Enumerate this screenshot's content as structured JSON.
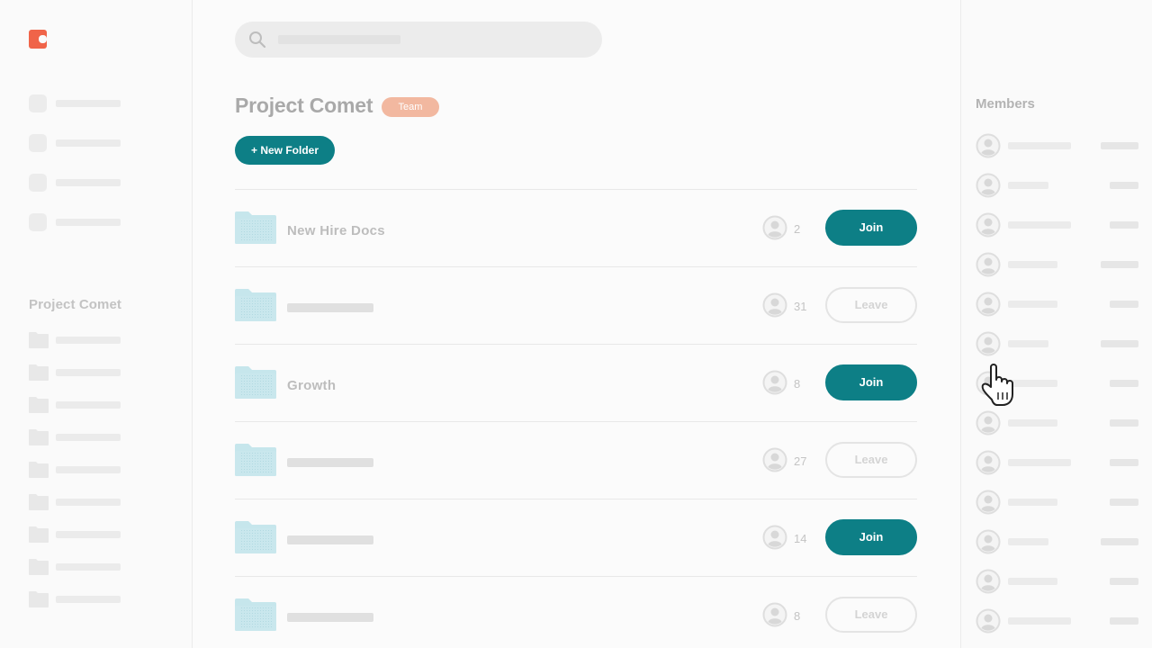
{
  "app": {
    "brand_color": "#f06449",
    "accent_color": "#0d7f86",
    "logo_icon": "brand-logo-icon"
  },
  "search": {
    "icon": "search-icon",
    "placeholder": ""
  },
  "sidebar": {
    "nav_items": [
      {
        "icon": "nav-square-icon"
      },
      {
        "icon": "nav-square-icon"
      },
      {
        "icon": "nav-square-icon"
      },
      {
        "icon": "nav-square-icon"
      }
    ],
    "section_title": "Project Comet",
    "folder_count": 9
  },
  "header": {
    "title": "Project Comet",
    "badge": "Team",
    "badge_color": "#f2b8a0",
    "new_folder_label": "+ New Folder"
  },
  "folders": [
    {
      "name": "New Hire Docs",
      "members": "2",
      "action": "Join"
    },
    {
      "name": "",
      "members": "31",
      "action": "Leave"
    },
    {
      "name": "Growth",
      "members": "8",
      "action": "Join"
    },
    {
      "name": "",
      "members": "27",
      "action": "Leave"
    },
    {
      "name": "",
      "members": "14",
      "action": "Join"
    },
    {
      "name": "",
      "members": "8",
      "action": "Leave"
    }
  ],
  "members_panel": {
    "title": "Members",
    "count": 13
  },
  "cursor": {
    "icon": "hand-pointer-icon"
  }
}
